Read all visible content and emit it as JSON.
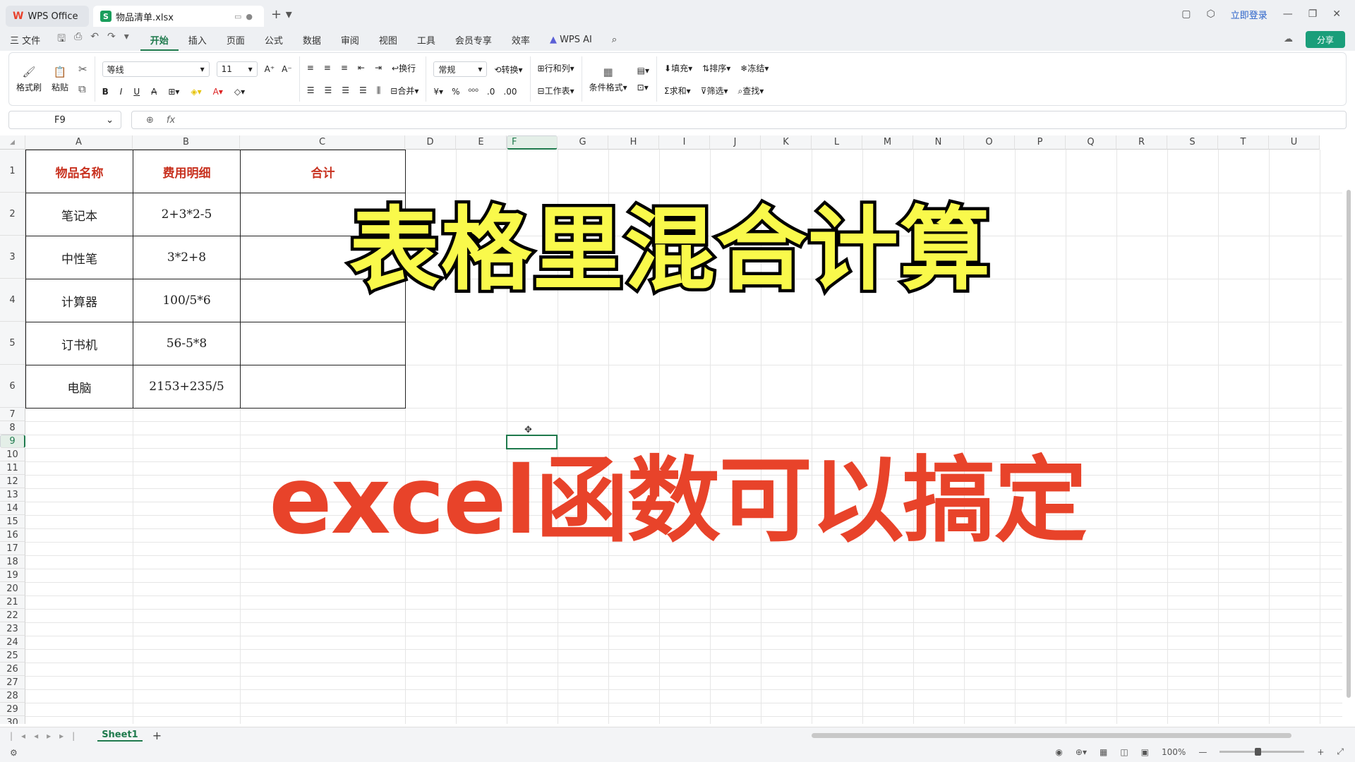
{
  "titlebar": {
    "home_tab": "WPS Office",
    "file_tab": "物品清单.xlsx",
    "login": "立即登录"
  },
  "menu": {
    "file": "三 文件",
    "items": [
      "开始",
      "插入",
      "页面",
      "公式",
      "数据",
      "审阅",
      "视图",
      "工具",
      "会员专享",
      "效率"
    ],
    "active": "开始",
    "ai": "WPS AI",
    "share": "分享"
  },
  "ribbon": {
    "format_painter": "格式刷",
    "paste": "粘贴",
    "font_name": "等线",
    "font_size": "11",
    "wrap": "换行",
    "merge": "合并",
    "number_format": "常规",
    "convert": "转换",
    "rows_cols": "行和列",
    "worksheet": "工作表",
    "cond_format": "条件格式",
    "fill": "填充",
    "sort": "排序",
    "freeze": "冻结",
    "sum": "求和",
    "filter": "筛选",
    "find": "查找"
  },
  "formula_bar": {
    "cell_ref": "F9",
    "fx": "fx",
    "content": ""
  },
  "columns": [
    "A",
    "B",
    "C",
    "D",
    "E",
    "F",
    "G",
    "H",
    "I",
    "J",
    "K",
    "L",
    "M",
    "N",
    "O",
    "P",
    "Q",
    "R",
    "S",
    "T",
    "U"
  ],
  "selected_column": "F",
  "selected_row": "9",
  "table": {
    "headers": [
      "物品名称",
      "费用明细",
      "合计"
    ],
    "rows": [
      [
        "笔记本",
        "2+3*2-5",
        ""
      ],
      [
        "中性笔",
        "3*2+8",
        ""
      ],
      [
        "计算器",
        "100/5*6",
        ""
      ],
      [
        "订书机",
        "56-5*8",
        ""
      ],
      [
        "电脑",
        "2153+235/5",
        ""
      ]
    ]
  },
  "overlay": {
    "title": "表格里混合计算",
    "subtitle": "excel函数可以搞定"
  },
  "sheets": {
    "active": "Sheet1"
  },
  "status": {
    "zoom": "100%"
  },
  "colors": {
    "accent": "#1f7a4d",
    "header_text": "#c8311f",
    "title_fill": "#f9f94b",
    "subtitle": "#e8432a"
  }
}
